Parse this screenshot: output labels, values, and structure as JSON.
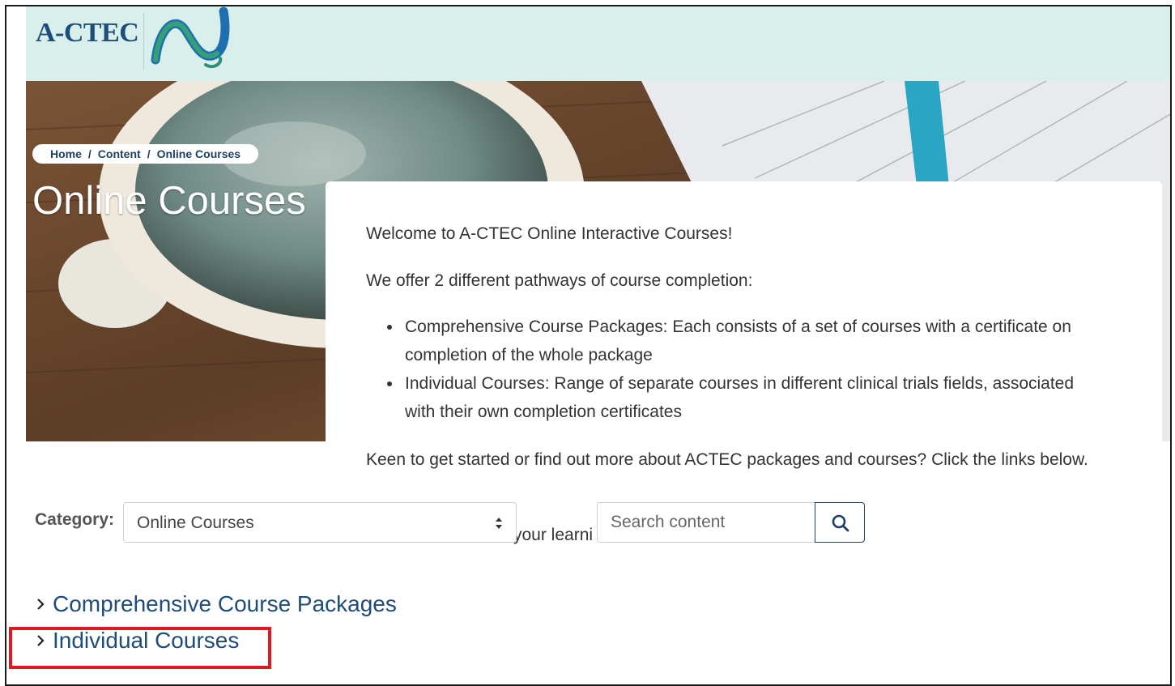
{
  "header": {
    "logo_text": "A-CTEC",
    "logo_icon": "actec-wave-logo-icon"
  },
  "breadcrumb": {
    "items": [
      "Home",
      "Content",
      "Online Courses"
    ],
    "separator": "/"
  },
  "page_title": "Online Courses",
  "intro": {
    "welcome": "Welcome to A-CTEC Online Interactive Courses!",
    "offer": "We offer 2 different pathways of course completion:",
    "bullets": [
      "Comprehensive Course Packages: Each consists of a set of courses with a certificate on completion of the whole package",
      "Individual Courses: Range of separate courses in different clinical trials fields, associated with their own completion certificates"
    ],
    "keen": "Keen to get started or find out more about ACTEC packages and courses? Click the links below.",
    "partial_line": "your learni"
  },
  "filter": {
    "category_label": "Category:",
    "category_selected": "Online Courses",
    "search_placeholder": "Search content",
    "search_icon": "search-icon"
  },
  "categories": [
    {
      "label": "Comprehensive Course Packages",
      "icon": "chevron-right-icon"
    },
    {
      "label": "Individual Courses",
      "icon": "chevron-right-icon"
    }
  ],
  "colors": {
    "header_bg": "#d9efec",
    "brand_navy": "#1f4c79",
    "link": "#1f4c79",
    "highlight": "#e0191f"
  }
}
